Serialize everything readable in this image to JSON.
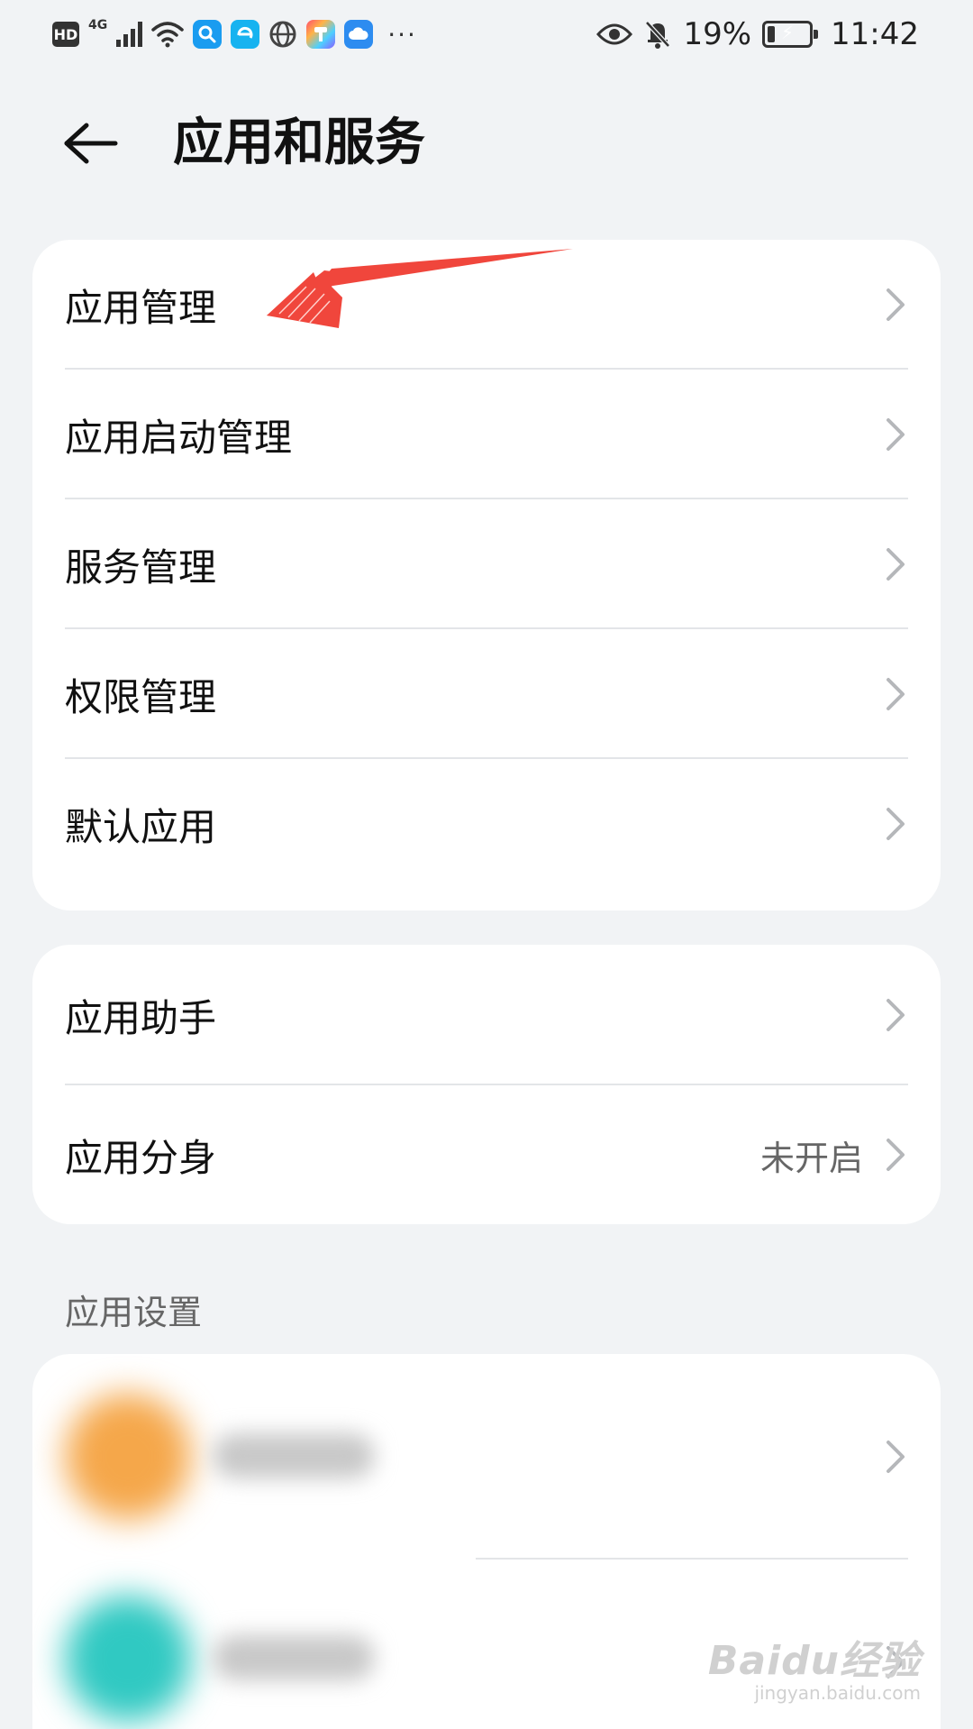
{
  "status_bar": {
    "hd": "HD",
    "network": "4G",
    "time": "11:42",
    "battery": "19%",
    "battery_level": 0.19,
    "more": "···",
    "icons_left": [
      "hd-badge",
      "cellular-signal-icon",
      "wifi-icon",
      "search-app-icon",
      "browser-app-icon",
      "globe-app-icon",
      "color-app-icon",
      "cloud-app-icon",
      "more-icon"
    ],
    "icons_right": [
      "eye-icon",
      "bell-muted-icon",
      "battery-charging-icon"
    ]
  },
  "header": {
    "title": "应用和服务"
  },
  "group1": {
    "items": [
      {
        "label": "应用管理"
      },
      {
        "label": "应用启动管理"
      },
      {
        "label": "服务管理"
      },
      {
        "label": "权限管理"
      },
      {
        "label": "默认应用"
      }
    ]
  },
  "group2": {
    "items": [
      {
        "label": "应用助手",
        "value": ""
      },
      {
        "label": "应用分身",
        "value": "未开启"
      }
    ]
  },
  "section": {
    "title": "应用设置"
  },
  "watermark": {
    "main": "Baidu经验",
    "sub": "jingyan.baidu.com"
  },
  "colors": {
    "background": "#f1f3f5",
    "card": "#ffffff",
    "annotation_arrow": "#f0463c",
    "blur_icon_1": "#f5a74a",
    "blur_icon_2": "#30c9c2"
  }
}
